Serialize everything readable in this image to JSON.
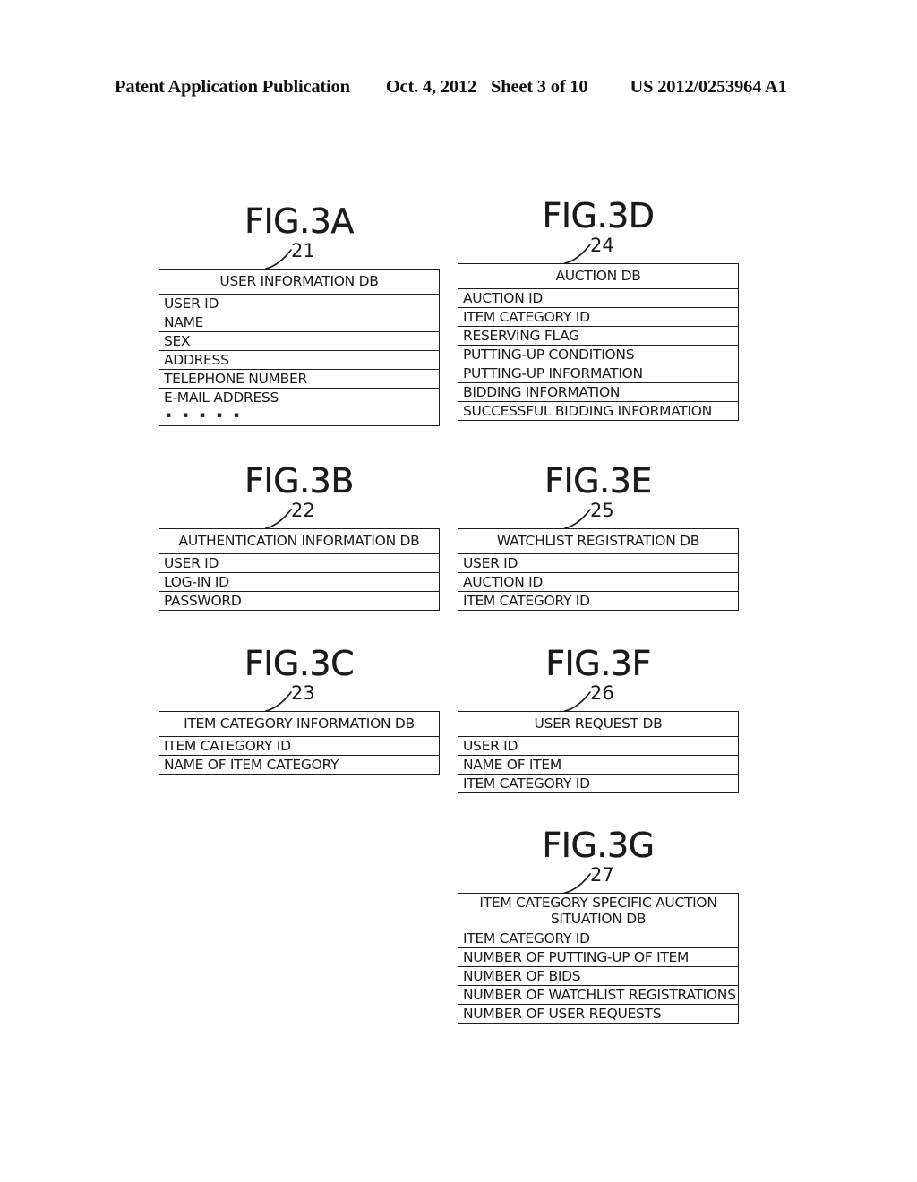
{
  "header": {
    "publication": "Patent Application Publication",
    "date": "Oct. 4, 2012",
    "sheet": "Sheet 3 of 10",
    "patent_number": "US 2012/0253964 A1"
  },
  "figures": [
    {
      "id": "fig-3a",
      "title": "FIG.3A",
      "ref": "21",
      "db_title": "USER INFORMATION DB",
      "db_title_line2": "",
      "rows": [
        "USER ID",
        "NAME",
        "SEX",
        "ADDRESS",
        "TELEPHONE NUMBER",
        "E-MAIL ADDRESS"
      ],
      "trailing_dots": "▪ ▪ ▪ ▪ ▪"
    },
    {
      "id": "fig-3b",
      "title": "FIG.3B",
      "ref": "22",
      "db_title": "AUTHENTICATION INFORMATION DB",
      "db_title_line2": "",
      "rows": [
        "USER ID",
        "LOG-IN ID",
        "PASSWORD"
      ],
      "trailing_dots": ""
    },
    {
      "id": "fig-3c",
      "title": "FIG.3C",
      "ref": "23",
      "db_title": "ITEM CATEGORY INFORMATION DB",
      "db_title_line2": "",
      "rows": [
        "ITEM CATEGORY ID",
        "NAME OF ITEM CATEGORY"
      ],
      "trailing_dots": ""
    },
    {
      "id": "fig-3d",
      "title": "FIG.3D",
      "ref": "24",
      "db_title": "AUCTION DB",
      "db_title_line2": "",
      "rows": [
        "AUCTION ID",
        "ITEM CATEGORY ID",
        "RESERVING FLAG",
        "PUTTING-UP CONDITIONS",
        "PUTTING-UP INFORMATION",
        "BIDDING INFORMATION",
        "SUCCESSFUL BIDDING INFORMATION"
      ],
      "trailing_dots": ""
    },
    {
      "id": "fig-3e",
      "title": "FIG.3E",
      "ref": "25",
      "db_title": "WATCHLIST REGISTRATION DB",
      "db_title_line2": "",
      "rows": [
        "USER ID",
        "AUCTION ID",
        "ITEM CATEGORY ID"
      ],
      "trailing_dots": ""
    },
    {
      "id": "fig-3f",
      "title": "FIG.3F",
      "ref": "26",
      "db_title": "USER REQUEST DB",
      "db_title_line2": "",
      "rows": [
        "USER ID",
        "NAME OF ITEM",
        "ITEM CATEGORY ID"
      ],
      "trailing_dots": ""
    },
    {
      "id": "fig-3g",
      "title": "FIG.3G",
      "ref": "27",
      "db_title": "ITEM CATEGORY SPECIFIC AUCTION",
      "db_title_line2": "SITUATION DB",
      "rows": [
        "ITEM CATEGORY ID",
        "NUMBER OF PUTTING-UP OF  ITEM",
        "NUMBER OF BIDS",
        "NUMBER OF WATCHLIST REGISTRATIONS",
        "NUMBER OF USER REQUESTS"
      ],
      "trailing_dots": ""
    }
  ]
}
